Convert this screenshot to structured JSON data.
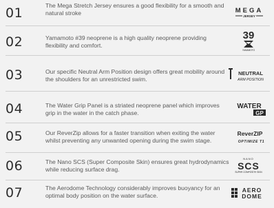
{
  "features": [
    {
      "num": "01",
      "text": "The Mega Stretch Jersey ensures a good flexibility for a smooth and natural stroke",
      "logo": {
        "icon": "mega-jersey-logo",
        "line1": "MEGA",
        "line2": "JERSEY"
      }
    },
    {
      "num": "02",
      "text": "Yamamoto #39 neoprene is a high quality neoprene providing flexibility and comfort.",
      "logo": {
        "icon": "yamamoto-39-logo",
        "line1": "39",
        "line2": "YAMAMOTO"
      }
    },
    {
      "num": "03",
      "text": "Our specific Neutral Arm Position design offers great mobility around the shoulders for an unrestricted swim.",
      "logo": {
        "icon": "neutral-arm-position-logo",
        "line1": "NEUTRAL",
        "line2": "ARM POSITION"
      }
    },
    {
      "num": "04",
      "text": "The Water Grip Panel is a striated neoprene panel which improves grip in the water in the catch phase.",
      "logo": {
        "icon": "water-grip-logo",
        "line1": "WATER",
        "line2": "GP"
      }
    },
    {
      "num": "05",
      "text": "Our ReverZip allows for a faster transition when exiting the water whilst preventing any unwanted opening during the swim stage.",
      "logo": {
        "icon": "reverzip-logo",
        "line1": "ReverZIP",
        "line2": "OPTIMIZE T1"
      }
    },
    {
      "num": "06",
      "text": "The Nano SCS (Super Composite Skin) ensures great hydrodynamics while reducing surface drag.",
      "logo": {
        "icon": "nano-scs-logo",
        "line1": "NANO",
        "line2": "SCS",
        "line3": "SUPER COMPOSITE SKIN"
      }
    },
    {
      "num": "07",
      "text": "The Aerodome Technology considerably improves buoyancy for an optimal body position on the water surface.",
      "logo": {
        "icon": "aerodome-logo",
        "line1": "AERO",
        "line2": "DOME"
      }
    }
  ]
}
